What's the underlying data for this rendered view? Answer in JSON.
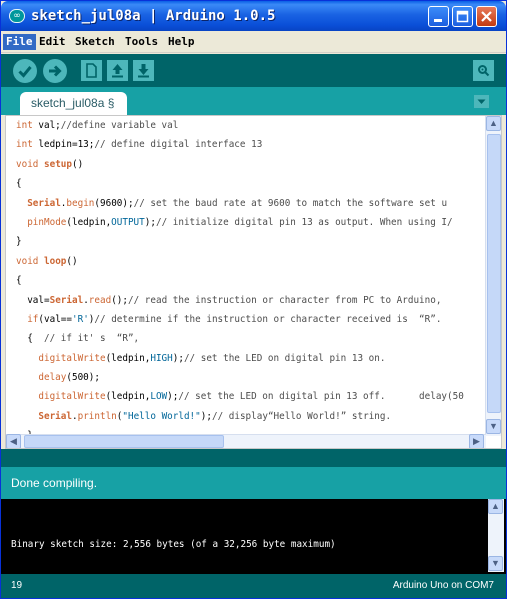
{
  "window": {
    "title": "sketch_jul08a | Arduino 1.0.5"
  },
  "menu": {
    "items": [
      "File",
      "Edit",
      "Sketch",
      "Tools",
      "Help"
    ]
  },
  "toolbar": {
    "icons": [
      "verify-icon",
      "upload-icon",
      "new-icon",
      "open-icon",
      "save-icon",
      "serial-monitor-icon"
    ]
  },
  "tabs": {
    "active": "sketch_jul08a §"
  },
  "code": {
    "lines": [
      [
        {
          "t": "int",
          "c": "kw-type"
        },
        {
          "t": " val;",
          "c": ""
        },
        {
          "t": "//define variable val",
          "c": "comment"
        }
      ],
      [
        {
          "t": "int",
          "c": "kw-type"
        },
        {
          "t": " ledpin=13;",
          "c": ""
        },
        {
          "t": "// define digital interface 13",
          "c": "comment"
        }
      ],
      [
        {
          "t": "void",
          "c": "kw-type"
        },
        {
          "t": " ",
          "c": ""
        },
        {
          "t": "setup",
          "c": "kw-fn"
        },
        {
          "t": "()",
          "c": ""
        }
      ],
      [
        {
          "t": "{",
          "c": ""
        }
      ],
      [
        {
          "t": "  ",
          "c": ""
        },
        {
          "t": "Serial",
          "c": "kw-ser"
        },
        {
          "t": ".",
          "c": ""
        },
        {
          "t": "begin",
          "c": "kw-type"
        },
        {
          "t": "(9600);",
          "c": ""
        },
        {
          "t": "// set the baud rate at 9600 to match the software set u",
          "c": "comment"
        }
      ],
      [
        {
          "t": "  ",
          "c": ""
        },
        {
          "t": "pinMode",
          "c": "kw-type"
        },
        {
          "t": "(ledpin,",
          "c": ""
        },
        {
          "t": "OUTPUT",
          "c": "kw-const"
        },
        {
          "t": ");",
          "c": ""
        },
        {
          "t": "// initialize digital pin 13 as output. When using I/",
          "c": "comment"
        }
      ],
      [
        {
          "t": "}",
          "c": ""
        }
      ],
      [
        {
          "t": "void",
          "c": "kw-type"
        },
        {
          "t": " ",
          "c": ""
        },
        {
          "t": "loop",
          "c": "kw-fn"
        },
        {
          "t": "()",
          "c": ""
        }
      ],
      [
        {
          "t": "{",
          "c": ""
        }
      ],
      [
        {
          "t": "  val=",
          "c": ""
        },
        {
          "t": "Serial",
          "c": "kw-ser"
        },
        {
          "t": ".",
          "c": ""
        },
        {
          "t": "read",
          "c": "kw-type"
        },
        {
          "t": "();",
          "c": ""
        },
        {
          "t": "// read the instruction or character from PC to Arduino,",
          "c": "comment"
        }
      ],
      [
        {
          "t": "  ",
          "c": ""
        },
        {
          "t": "if",
          "c": "kw-type"
        },
        {
          "t": "(val==",
          "c": ""
        },
        {
          "t": "'R'",
          "c": "str"
        },
        {
          "t": ")",
          "c": ""
        },
        {
          "t": "// determine if the instruction or character received is  “R”.",
          "c": "comment"
        }
      ],
      [
        {
          "t": "  {  ",
          "c": ""
        },
        {
          "t": "// if it' s  “R”,",
          "c": "comment"
        }
      ],
      [
        {
          "t": "    ",
          "c": ""
        },
        {
          "t": "digitalWrite",
          "c": "kw-type"
        },
        {
          "t": "(ledpin,",
          "c": ""
        },
        {
          "t": "HIGH",
          "c": "kw-const"
        },
        {
          "t": ");",
          "c": ""
        },
        {
          "t": "// set the LED on digital pin 13 on.",
          "c": "comment"
        }
      ],
      [
        {
          "t": "    ",
          "c": ""
        },
        {
          "t": "delay",
          "c": "kw-type"
        },
        {
          "t": "(500);",
          "c": ""
        }
      ],
      [
        {
          "t": "    ",
          "c": ""
        },
        {
          "t": "digitalWrite",
          "c": "kw-type"
        },
        {
          "t": "(ledpin,",
          "c": ""
        },
        {
          "t": "LOW",
          "c": "kw-const"
        },
        {
          "t": ");",
          "c": ""
        },
        {
          "t": "// set the LED on digital pin 13 off.      delay(50",
          "c": "comment"
        }
      ],
      [
        {
          "t": "    ",
          "c": ""
        },
        {
          "t": "Serial",
          "c": "kw-ser"
        },
        {
          "t": ".",
          "c": ""
        },
        {
          "t": "println",
          "c": "kw-type"
        },
        {
          "t": "(",
          "c": ""
        },
        {
          "t": "\"Hello World!\"",
          "c": "str"
        },
        {
          "t": ");",
          "c": ""
        },
        {
          "t": "// display“Hello World!” string.",
          "c": "comment"
        }
      ],
      [
        {
          "t": "  }",
          "c": ""
        }
      ],
      [
        {
          "t": "}",
          "c": ""
        }
      ]
    ]
  },
  "status": {
    "message": "Done compiling."
  },
  "console": {
    "output": "Binary sketch size: 2,556 bytes (of a 32,256 byte maximum)"
  },
  "footer": {
    "line": "19",
    "board": "Arduino Uno on COM7"
  },
  "colors": {
    "teal_dark": "#006468",
    "teal_light": "#17a1a5",
    "icon_fill": "#4db7bb",
    "keyword": "#cc6633",
    "constant": "#006699"
  }
}
